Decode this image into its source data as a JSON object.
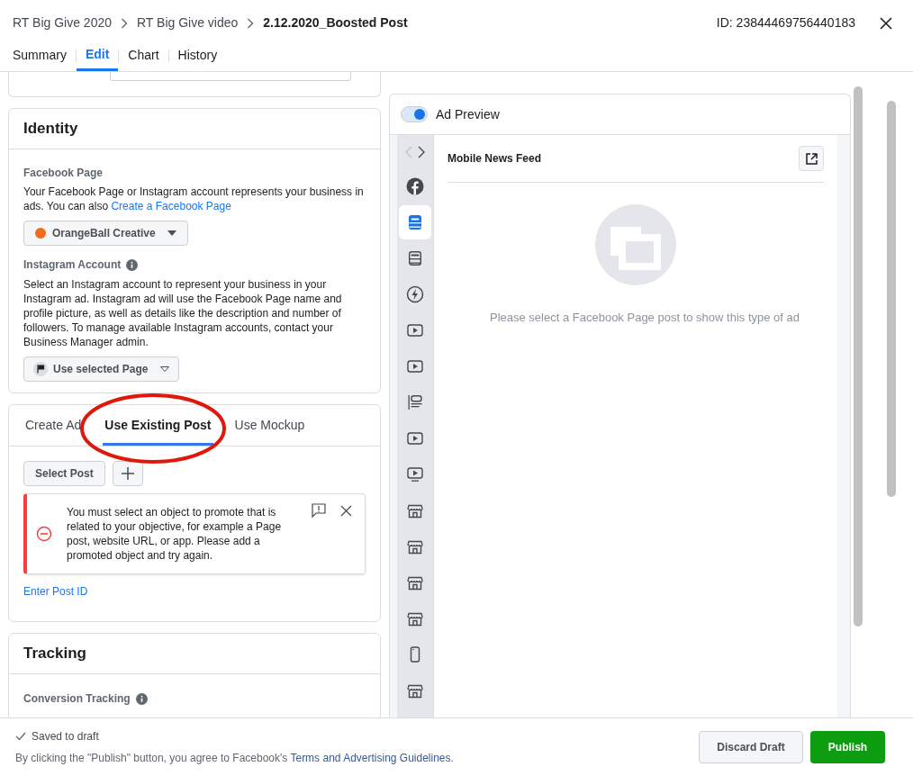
{
  "breadcrumb": [
    {
      "label": "RT Big Give 2020",
      "current": false
    },
    {
      "label": "RT Big Give video",
      "current": false
    },
    {
      "label": "2.12.2020_Boosted Post",
      "current": true
    }
  ],
  "ad_id": "ID: 23844469756440183",
  "tabs": [
    {
      "label": "Summary",
      "selected": false
    },
    {
      "label": "Edit",
      "selected": true
    },
    {
      "label": "Chart",
      "selected": false
    },
    {
      "label": "History",
      "selected": false
    }
  ],
  "identity": {
    "title": "Identity",
    "facebook_page": {
      "label": "Facebook Page",
      "description": "Your Facebook Page or Instagram account represents your business in ads. You can also",
      "link": "Create a Facebook Page",
      "value": "OrangeBall Creative"
    },
    "instagram": {
      "label": "Instagram Account",
      "description": "Select an Instagram account to represent your business in your Instagram ad. Instagram ad will use the Facebook Page name and profile picture, as well as details like the description and number of followers. To manage available Instagram accounts, contact your Business Manager admin.",
      "value": "Use selected Page"
    }
  },
  "creative": {
    "tabs": [
      {
        "label": "Create Ad",
        "selected": false
      },
      {
        "label": "Use Existing Post",
        "selected": true
      },
      {
        "label": "Use Mockup",
        "selected": false
      }
    ],
    "select_post": "Select Post",
    "error": "You must select an object to promote that is related to your objective, for example a Page post, website URL, or app. Please add a promoted object and try again.",
    "link": "Enter Post ID"
  },
  "tracking": {
    "title": "Tracking",
    "conversion_label": "Conversion Tracking"
  },
  "preview": {
    "on": true,
    "title": "Ad Preview",
    "placements": [
      {
        "kind": "facebook",
        "selected": false
      },
      {
        "kind": "feed",
        "selected": true
      },
      {
        "kind": "feed",
        "selected": false
      },
      {
        "kind": "instant",
        "selected": false
      },
      {
        "kind": "video",
        "selected": false
      },
      {
        "kind": "video",
        "selected": false
      },
      {
        "kind": "article",
        "selected": false
      },
      {
        "kind": "video",
        "selected": false
      },
      {
        "kind": "tv",
        "selected": false
      },
      {
        "kind": "store",
        "selected": false
      },
      {
        "kind": "store",
        "selected": false
      },
      {
        "kind": "store",
        "selected": false
      },
      {
        "kind": "store",
        "selected": false
      },
      {
        "kind": "phone",
        "selected": false
      },
      {
        "kind": "store",
        "selected": false
      }
    ],
    "feed_title": "Mobile News Feed",
    "empty_message": "Please select a Facebook Page post to show this type of ad"
  },
  "footer": {
    "status": "Saved to draft",
    "agreement": "By clicking the \"Publish\" button, you agree to Facebook's",
    "agreement_link": "Terms and Advertising Guidelines",
    "agreement_end": ".",
    "buttons": [
      {
        "label": "Discard Draft",
        "kind": "secondary"
      },
      {
        "label": "Publish",
        "kind": "primary"
      }
    ]
  }
}
